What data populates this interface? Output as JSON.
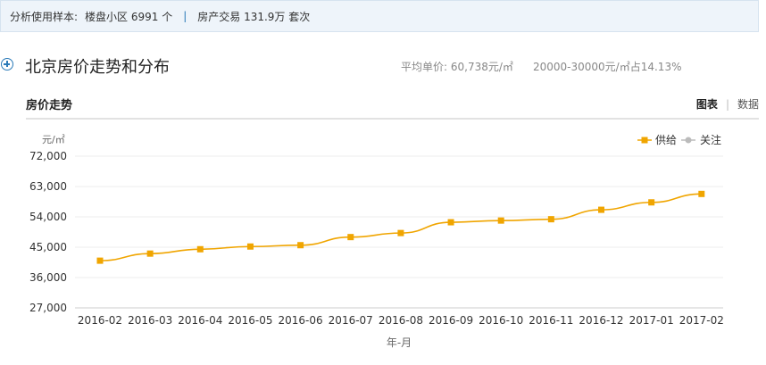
{
  "sample": {
    "label": "分析使用样本:",
    "communities": "楼盘小区 6991 个",
    "transactions": "房产交易 131.9万 套次"
  },
  "section": {
    "title": "北京房价走势和分布",
    "avg_price": "平均单价: 60,738元/㎡",
    "range_share": "20000-30000元/㎡占14.13%"
  },
  "trend": {
    "title": "房价走势",
    "tab_chart": "图表",
    "tab_data": "数据"
  },
  "colors": {
    "supply": "#f0a500",
    "attention": "#bbbbbb",
    "accent": "#2a7ab8"
  },
  "chart_data": {
    "type": "line",
    "ylabel": "元/㎡",
    "xlabel": "年-月",
    "ylim": [
      27000,
      72000
    ],
    "yticks": [
      27000,
      36000,
      45000,
      54000,
      63000,
      72000
    ],
    "ytick_labels": [
      "27,000",
      "36,000",
      "45,000",
      "54,000",
      "63,000",
      "72,000"
    ],
    "grid": true,
    "legend_position": "top-right",
    "categories": [
      "2016-02",
      "2016-03",
      "2016-04",
      "2016-05",
      "2016-06",
      "2016-07",
      "2016-08",
      "2016-09",
      "2016-10",
      "2016-11",
      "2016-12",
      "2017-01",
      "2017-02"
    ],
    "series": [
      {
        "name": "供给",
        "values": [
          41000,
          43100,
          44400,
          45200,
          45600,
          48000,
          49200,
          52400,
          52900,
          53300,
          56100,
          58300,
          60800
        ]
      },
      {
        "name": "关注",
        "values": []
      }
    ]
  }
}
